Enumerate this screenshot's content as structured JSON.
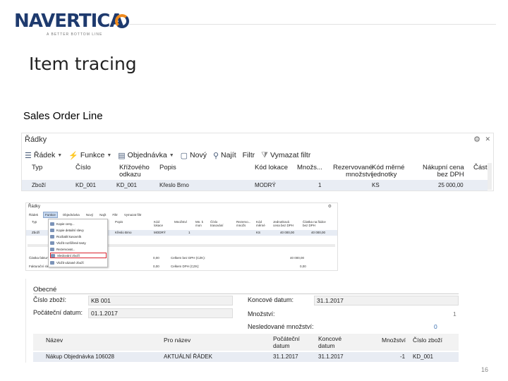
{
  "header": {
    "logo_text": "NAVERTICA",
    "logo_tagline": "A BETTER BOTTOM LINE",
    "title": "Item tracing",
    "subtitle": "Sales Order Line",
    "page_number": "16"
  },
  "screenshot_lines": {
    "panel_title": "Řádky",
    "toolbar": [
      {
        "label": "Řádek",
        "icon": "list-icon",
        "dropdown": true
      },
      {
        "label": "Funkce",
        "icon": "lightning-icon",
        "dropdown": true
      },
      {
        "label": "Objednávka",
        "icon": "document-icon",
        "dropdown": true
      },
      {
        "label": "Nový",
        "icon": "new-document-icon",
        "dropdown": false
      },
      {
        "label": "Najít",
        "icon": "binoculars-icon",
        "dropdown": false
      },
      {
        "label": "Filtr",
        "icon": "",
        "dropdown": false
      },
      {
        "label": "Vymazat filtr",
        "icon": "clear-filter-icon",
        "dropdown": false
      }
    ],
    "columns": [
      "Typ",
      "Číslo",
      "Křížového\nodkazu",
      "Popis",
      "Kód lokace",
      "Množs...",
      "Rezervované\nmnožství",
      "Kód měrné\njednotky",
      "Nákupní cena\nbez DPH",
      "Částk"
    ],
    "row": [
      "Zboží",
      "KD_001",
      "KD_001",
      "Křeslo Brno",
      "MODRÝ",
      "1",
      "",
      "KS",
      "25 000,00"
    ]
  },
  "screenshot_menu": {
    "panel_title": "Řádky",
    "toolbar": [
      "Řádek",
      "Funkce",
      "Objednávka",
      "Nový",
      "Najít",
      "Filtr",
      "Vymazat filtr"
    ],
    "columns": [
      "Typ",
      "Číslo",
      "Číslo\nkřížového",
      "Popis",
      "Kód\nlokace",
      "Množství",
      "Mn. k\nmon",
      "Číslo\ntrasování",
      "Rezervo...\nmnožs",
      "Kód\nměrné",
      "Jednotková\ncena bez DPH",
      "Částka na řádce\nbez DPH"
    ],
    "row": [
      "Zboží",
      "",
      "",
      "Křeslo Brno",
      "MODRÝ",
      "1",
      "",
      "",
      "",
      "KS",
      "40 000,00",
      "40 000,00"
    ],
    "menu_items": [
      "Kopie ceny...",
      "Kopie detailní slevy",
      "Rozbalit kusovník",
      "Vložit rozšířené texty",
      "Rezervovat...",
      "Sledování zboží",
      "Vložit vázané zboží"
    ],
    "highlighted_item": "Sledování zboží",
    "totals": [
      {
        "label": "Částka faktury",
        "value": "0,00",
        "label2": "Celkem bez DPH (CZK):",
        "value2": "40 000,00"
      },
      {
        "label": "Fakturační sleva",
        "value": "0,00",
        "label2": "Celkem DPH (CZK):",
        "value2": "0,00"
      }
    ]
  },
  "screenshot_tracing": {
    "section": "Obecné",
    "fields": {
      "item_no_label": "Číslo zboží:",
      "item_no_value": "KB 001",
      "start_date_label": "Počáteční datum:",
      "start_date_value": "01.1.2017",
      "end_date_label": "Koncové datum:",
      "end_date_value": "31.1.2017",
      "quantity_label": "Množství:",
      "quantity_value": "1",
      "untracked_label": "Nesledované množství:",
      "untracked_value": "0"
    },
    "columns": [
      "Název",
      "Pro název",
      "Počáteční\ndatum",
      "Koncové\ndatum",
      "Množství",
      "Číslo zboží"
    ],
    "row": [
      "Nákup Objednávka 106028",
      "AKTUÁLNÍ ŘÁDEK",
      "31.1.2017",
      "31.1.2017",
      "-1",
      "KD_001"
    ]
  }
}
